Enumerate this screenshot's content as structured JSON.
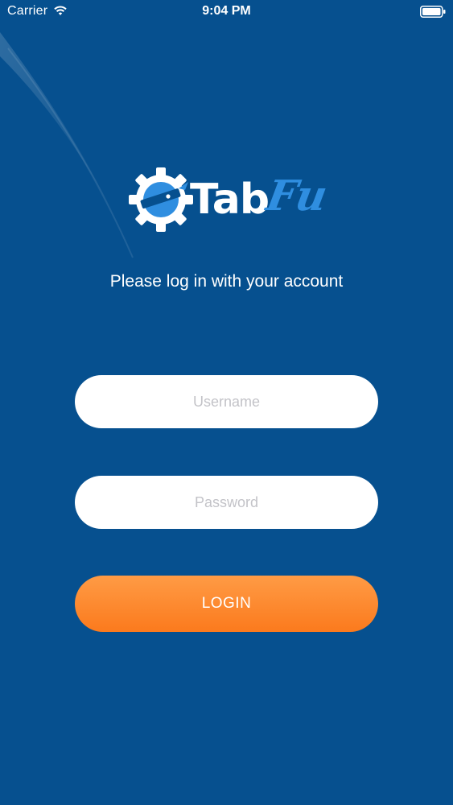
{
  "status_bar": {
    "carrier": "Carrier",
    "time": "9:04 PM",
    "wifi_icon": "wifi-icon",
    "battery_icon": "battery-full-icon"
  },
  "logo": {
    "part_tab": "Tab",
    "part_fu": "Fu",
    "icon": "gear-icon",
    "accent_color": "#2f8ee0"
  },
  "subtitle": "Please log in with your account",
  "form": {
    "username": {
      "value": "",
      "placeholder": "Username"
    },
    "password": {
      "value": "",
      "placeholder": "Password"
    },
    "login_label": "LOGIN"
  },
  "colors": {
    "background": "#06508f",
    "button": "#fb7a1d",
    "field": "#ffffff"
  }
}
